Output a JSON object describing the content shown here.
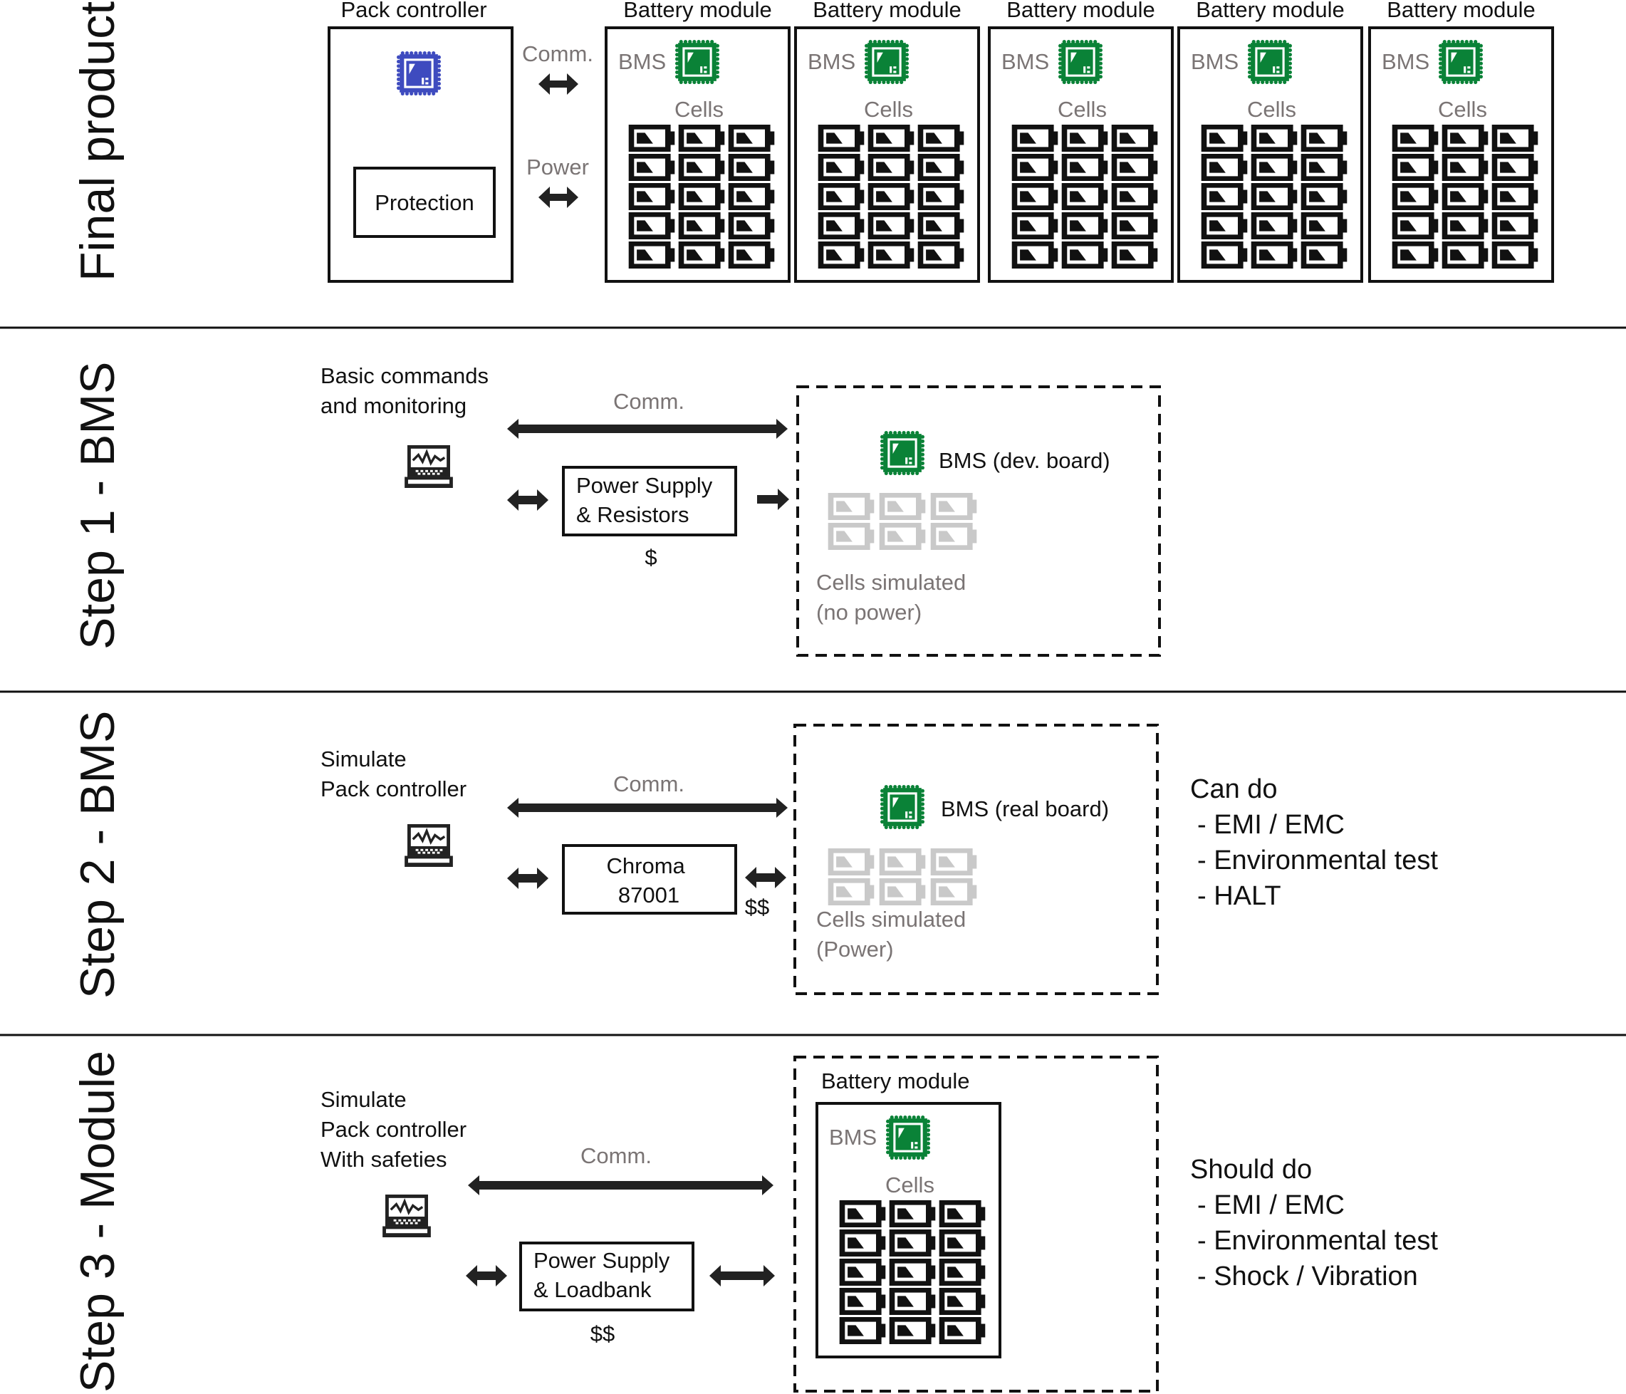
{
  "colors": {
    "ink": "#111111",
    "muted_text": "#7a7474",
    "bms_chip": "#0a8237",
    "pack_chip": "#3e4bbf",
    "simulated_cell": "#c9c9c9"
  },
  "rows": {
    "final": {
      "label": "Final product",
      "pack_controller": {
        "title": "Pack controller",
        "protection_label": "Protection",
        "chip_icon": "microchip-icon"
      },
      "links": {
        "comm_label": "Comm.",
        "power_label": "Power"
      },
      "modules": [
        {
          "title": "Battery module",
          "bms_label": "BMS",
          "cells_label": "Cells"
        },
        {
          "title": "Battery module",
          "bms_label": "BMS",
          "cells_label": "Cells"
        },
        {
          "title": "Battery module",
          "bms_label": "BMS",
          "cells_label": "Cells"
        },
        {
          "title": "Battery module",
          "bms_label": "BMS",
          "cells_label": "Cells"
        },
        {
          "title": "Battery module",
          "bms_label": "BMS",
          "cells_label": "Cells"
        }
      ],
      "cell_grid": {
        "rows": 5,
        "cols": 3
      }
    },
    "step1": {
      "label": "Step 1 - BMS",
      "desc_lines": [
        "Basic commands",
        "and monitoring"
      ],
      "comm_label": "Comm.",
      "equipment_lines": [
        "Power Supply",
        "& Resistors"
      ],
      "cost": "$",
      "dut_label": "BMS (dev. board)",
      "cells_lines": [
        "Cells simulated",
        "(no power)"
      ],
      "cell_grid": {
        "rows": 2,
        "cols": 3
      }
    },
    "step2": {
      "label": "Step 2 - BMS",
      "desc_lines": [
        "Simulate",
        "Pack controller"
      ],
      "comm_label": "Comm.",
      "equipment_lines": [
        "Chroma",
        "87001"
      ],
      "cost": "$$",
      "dut_label": "BMS (real board)",
      "cells_lines": [
        "Cells simulated",
        "(Power)"
      ],
      "cell_grid": {
        "rows": 2,
        "cols": 3
      },
      "tests": {
        "heading": "Can do",
        "items": [
          "- EMI / EMC",
          "- Environmental test",
          "- HALT"
        ]
      }
    },
    "step3": {
      "label": "Step 3 - Module",
      "desc_lines": [
        "Simulate",
        "Pack controller",
        "With safeties"
      ],
      "comm_label": "Comm.",
      "equipment_lines": [
        "Power Supply",
        "& Loadbank"
      ],
      "cost": "$$",
      "module": {
        "title": "Battery module",
        "bms_label": "BMS",
        "cells_label": "Cells"
      },
      "cell_grid": {
        "rows": 5,
        "cols": 3
      },
      "tests": {
        "heading": "Should do",
        "items": [
          "- EMI / EMC",
          "- Environmental test",
          "- Shock / Vibration"
        ]
      }
    }
  }
}
